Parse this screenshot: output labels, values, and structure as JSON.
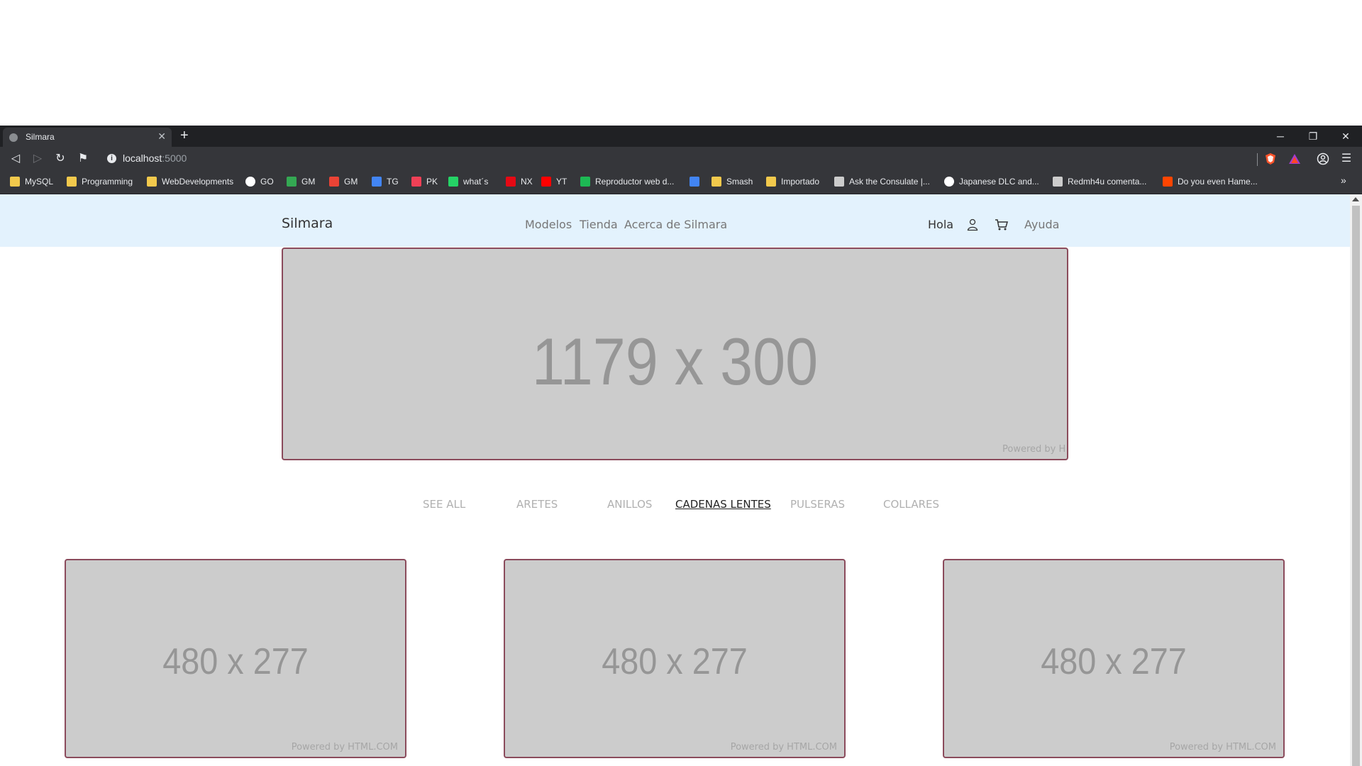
{
  "browser": {
    "tab_title": "Silmara",
    "tab_close": "✕",
    "new_tab": "+",
    "url_host": "localhost",
    "url_port": ":5000",
    "window": {
      "minimize": "─",
      "restore": "❐",
      "close": "✕"
    },
    "nav": {
      "back": "◁",
      "forward": "▷",
      "reload": "↻",
      "bookmark": "⚑"
    },
    "menu": "☰",
    "bookmarks": [
      {
        "label": "MySQL",
        "icon": "folder-icon",
        "color": "#f2c94c"
      },
      {
        "label": "Programming",
        "icon": "folder-icon",
        "color": "#f2c94c"
      },
      {
        "label": "WebDevelopments",
        "icon": "folder-icon",
        "color": "#f2c94c"
      },
      {
        "label": "GO",
        "icon": "google-icon",
        "color": "#ffffff"
      },
      {
        "label": "GM",
        "icon": "maps-icon",
        "color": "#34a853"
      },
      {
        "label": "GM",
        "icon": "gmail-icon",
        "color": "#ea4335"
      },
      {
        "label": "TG",
        "icon": "translate-icon",
        "color": "#4285f4"
      },
      {
        "label": "PK",
        "icon": "pocket-icon",
        "color": "#ef4056"
      },
      {
        "label": "what´s",
        "icon": "whatsapp-icon",
        "color": "#25d366"
      },
      {
        "label": "NX",
        "icon": "netflix-icon",
        "color": "#e50914"
      },
      {
        "label": "YT",
        "icon": "youtube-icon",
        "color": "#ff0000"
      },
      {
        "label": "Reproductor web d...",
        "icon": "spotify-icon",
        "color": "#1db954"
      },
      {
        "label": "",
        "icon": "docs-icon",
        "color": "#4285f4"
      },
      {
        "label": "Smash",
        "icon": "folder-icon",
        "color": "#f2c94c"
      },
      {
        "label": "Importado",
        "icon": "folder-icon",
        "color": "#f2c94c"
      },
      {
        "label": "Ask the Consulate |...",
        "icon": "consulate-icon",
        "color": "#cccccc"
      },
      {
        "label": "Japanese DLC and...",
        "icon": "globe-icon",
        "color": "#ffffff"
      },
      {
        "label": "Redmh4u comenta...",
        "icon": "page-icon",
        "color": "#cccccc"
      },
      {
        "label": "Do you even Hame...",
        "icon": "reddit-icon",
        "color": "#ff4500"
      }
    ],
    "bookmarks_overflow": "»"
  },
  "site": {
    "brand": "Silmara",
    "menu": [
      "Modelos",
      "Tienda",
      "Acerca de Silmara"
    ],
    "greeting": "Hola",
    "user_icon": "user-icon",
    "cart_icon": "cart-icon",
    "help": "Ayuda",
    "hero": {
      "placeholder": "1179 x 300",
      "powered": "Powered by H"
    },
    "categories": [
      {
        "label": "SEE ALL",
        "active": false
      },
      {
        "label": "ARETES",
        "active": false
      },
      {
        "label": "ANILLOS",
        "active": false
      },
      {
        "label": "CADENAS LENTES",
        "active": true
      },
      {
        "label": "PULSERAS",
        "active": false
      },
      {
        "label": "COLLARES",
        "active": false
      }
    ],
    "cards": [
      {
        "placeholder": "480 x 277",
        "powered": "Powered by HTML.COM"
      },
      {
        "placeholder": "480 x 277",
        "powered": "Powered by HTML.COM"
      },
      {
        "placeholder": "480 x 277",
        "powered": "Powered by HTML.COM"
      }
    ]
  },
  "colors": {
    "nav_bg": "#e3f2fd",
    "placeholder_bg": "#cccccc",
    "placeholder_border": "#8b4b5c",
    "chrome_dark": "#202124",
    "chrome_toolbar": "#35363a"
  }
}
